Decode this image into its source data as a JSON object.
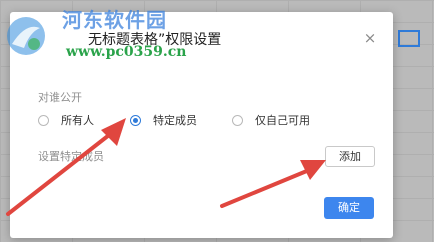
{
  "dialog": {
    "title": "无标题表格”权限设置",
    "close_symbol": "×",
    "visibility_label": "对谁公开",
    "options": [
      {
        "label": "所有人",
        "checked": false
      },
      {
        "label": "特定成员",
        "checked": true
      },
      {
        "label": "仅自己可用",
        "checked": false
      }
    ],
    "members_label": "设置特定成员",
    "add_button": "添加",
    "confirm_button": "确定"
  },
  "watermark": {
    "site_name": "河东软件园",
    "url": "www.pc0359.cn"
  },
  "colors": {
    "accent": "#3d86ee",
    "annotation_arrow": "#e0463f",
    "watermark_green": "#2aa34a"
  }
}
